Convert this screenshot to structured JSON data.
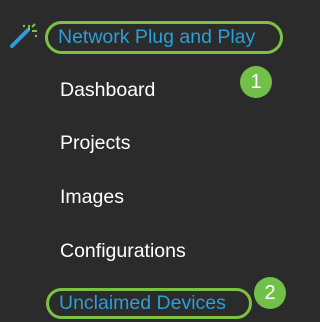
{
  "sidebar": {
    "section_title": "Network Plug and Play",
    "section_icon": "magic-wand-icon",
    "items": [
      {
        "label": "Dashboard"
      },
      {
        "label": "Projects"
      },
      {
        "label": "Images"
      },
      {
        "label": "Configurations"
      },
      {
        "label": "Unclaimed Devices"
      }
    ]
  },
  "annotations": {
    "step1": "1",
    "step2": "2"
  },
  "colors": {
    "background": "#2b2b2b",
    "highlight_green": "#7cc242",
    "badge_green": "#72c04a",
    "link_blue": "#2a9fd8",
    "text_white": "#ffffff"
  }
}
